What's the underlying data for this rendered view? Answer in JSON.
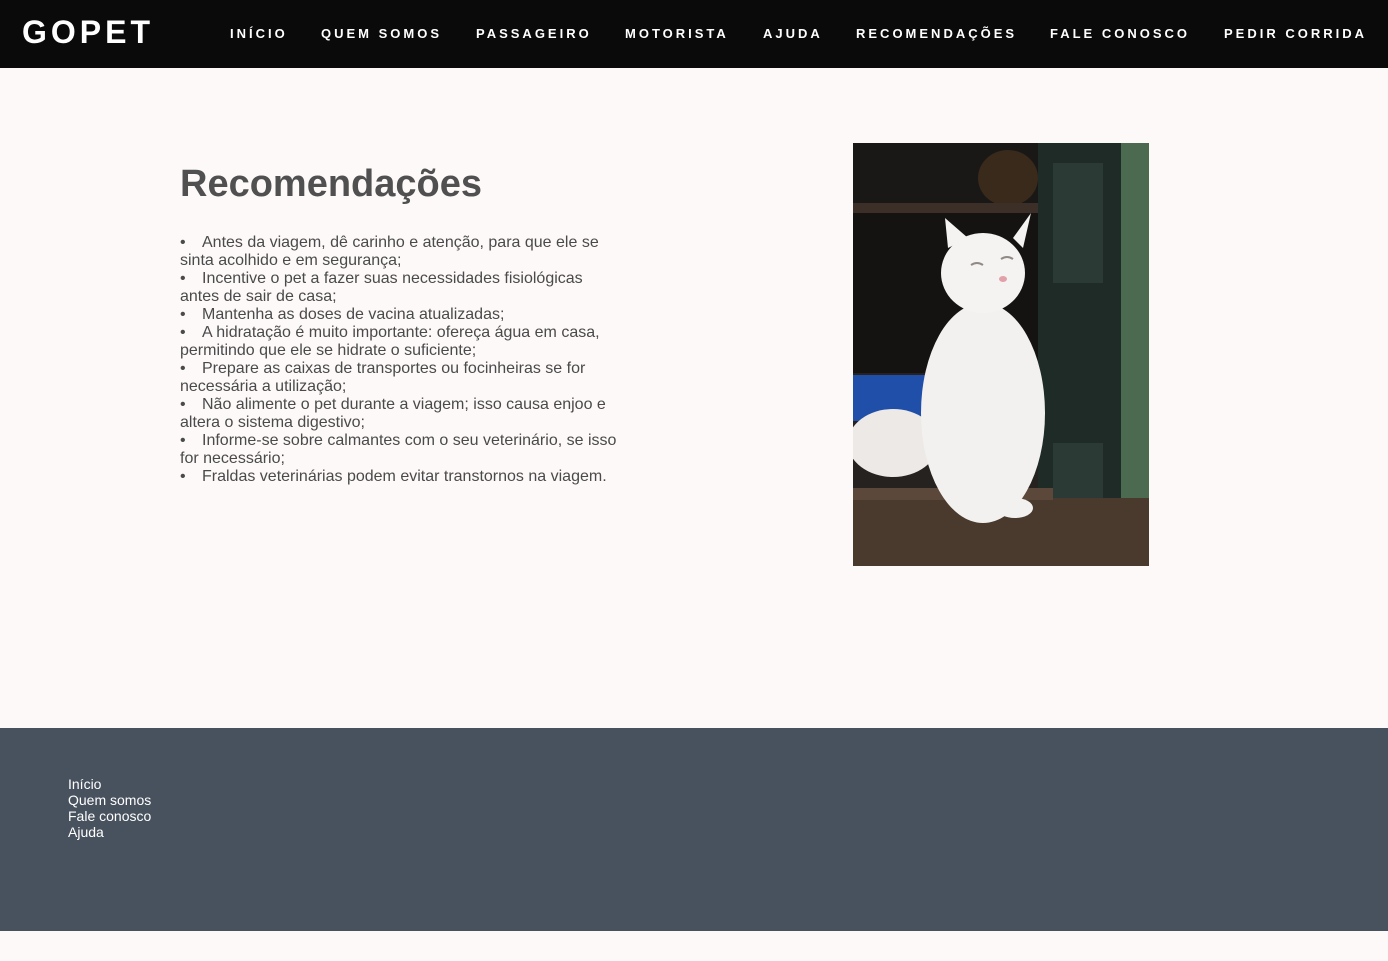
{
  "header": {
    "brand": "GOPET",
    "nav": [
      {
        "label": "INÍCIO"
      },
      {
        "label": "QUEM SOMOS"
      },
      {
        "label": "PASSAGEIRO"
      },
      {
        "label": "MOTORISTA"
      },
      {
        "label": "AJUDA"
      },
      {
        "label": "RECOMENDAÇÕES"
      },
      {
        "label": "FALE CONOSCO"
      },
      {
        "label": "PEDIR CORRIDA"
      }
    ]
  },
  "main": {
    "title": "Recomendações",
    "recommendations": [
      "Antes da viagem, dê carinho e atenção, para que ele se sinta acolhido e em segurança;",
      "Incentive o pet a fazer suas necessidades fisiológicas antes de sair de casa;",
      "Mantenha as doses de vacina atualizadas;",
      "A hidratação é muito importante: ofereça água em casa, permitindo que ele se hidrate o suficiente;",
      "Prepare as caixas de transportes ou focinheiras se for necessária a utilização;",
      "Não alimente o pet durante a viagem; isso causa enjoo e altera o sistema digestivo;",
      "Informe-se sobre calmantes com o seu veterinário, se isso for necessário;",
      "Fraldas veterinárias podem evitar transtornos na viagem."
    ]
  },
  "footer": {
    "links": [
      {
        "label": "Início"
      },
      {
        "label": "Quem somos"
      },
      {
        "label": "Fale conosco"
      },
      {
        "label": "Ajuda"
      }
    ]
  },
  "colors": {
    "header_bg": "#0a0a0a",
    "page_bg": "#fdf9f8",
    "footer_bg": "#48515e",
    "text": "#4a4a4a"
  }
}
